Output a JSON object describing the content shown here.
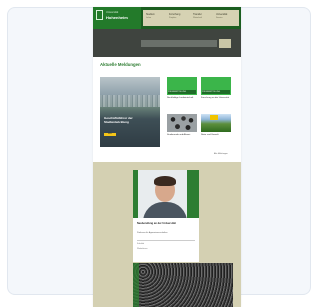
{
  "header": {
    "logo_small": "Universität",
    "logo_large": "Hohenheim",
    "nav": [
      {
        "label": "Studium",
        "sub": "Lehre"
      },
      {
        "label": "Forschung",
        "sub": "Projekte"
      },
      {
        "label": "Transfer",
        "sub": "Wirtschaft"
      },
      {
        "label": "Universität",
        "sub": "Service"
      }
    ]
  },
  "search": {
    "placeholder": ""
  },
  "headline": "Aktuelle Meldungen",
  "featured": {
    "title": "Geschäftsführer der Stadtentwicklung",
    "button": "Mehr"
  },
  "tiles": [
    {
      "label": "PRESSEMITTEILUNG",
      "caption": "Nachhaltige Landwirtschaft"
    },
    {
      "label": "PRESSEMITTEILUNG",
      "caption": "Forschung an der Universität"
    },
    {
      "label": "",
      "caption": "Studierende und Alumni"
    },
    {
      "label": "",
      "caption": "Natur und Umwelt"
    }
  ],
  "more_link": "Alle Meldungen",
  "profile": {
    "title": "Neuberufung an der Universität",
    "subtitle": "Professor für Agrarwissenschaften",
    "meta1": "Fakultät",
    "meta2": "Weiterlesen"
  },
  "colors": {
    "brand_green": "#2e7d32",
    "beige": "#d4d0b2",
    "dark_band": "#3f443f"
  }
}
